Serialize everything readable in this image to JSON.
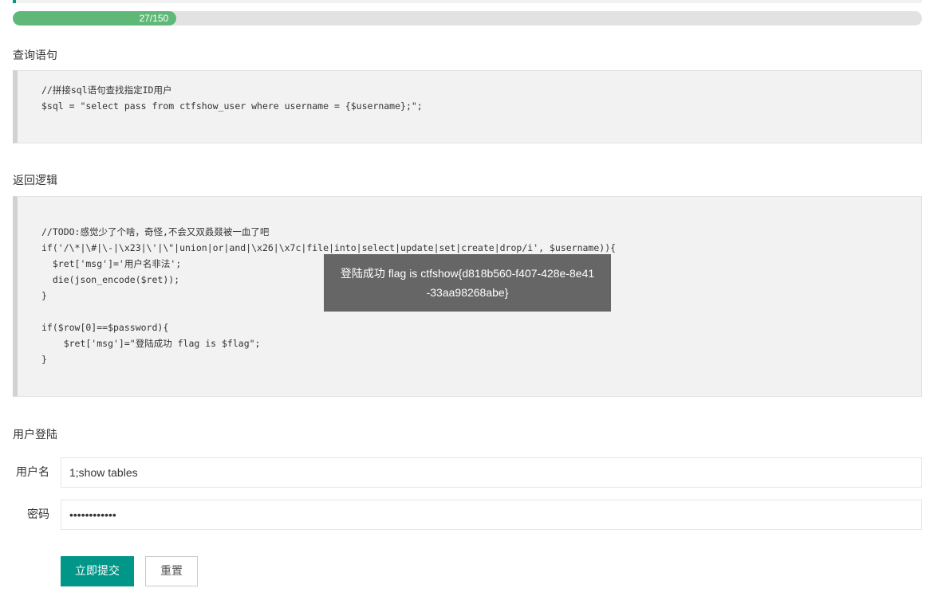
{
  "progress": {
    "text": "27/150",
    "fraction": 0.18,
    "color": "#5fb878"
  },
  "query_section": {
    "title": "查询语句",
    "lines": [
      "//拼接sql语句查找指定ID用户",
      "$sql = \"select pass from ctfshow_user where username = {$username};\";"
    ]
  },
  "logic_section": {
    "title": "返回逻辑",
    "lines": [
      "//TODO:感觉少了个啥，奇怪,不会又双叒叕被一血了吧",
      "if('/\\*|\\#|\\-|\\x23|\\'|\\\"|union|or|and|\\x26|\\x7c|file|into|select|update|set|create|drop/i', $username)){",
      "  $ret['msg']='用户名非法';",
      "  die(json_encode($ret));",
      "}",
      "",
      "if($row[0]==$password){",
      "    $ret['msg']=\"登陆成功 flag is $flag\";",
      "}"
    ]
  },
  "toast": {
    "message": "登陆成功 flag is ctfshow{d818b560-f407-428e-8e41-33aa98268abe}"
  },
  "login_section": {
    "title": "用户登陆",
    "username_label": "用户名",
    "username_value": "1;show tables",
    "password_label": "密码",
    "password_value": "••••••••••••",
    "submit_label": "立即提交",
    "reset_label": "重置"
  },
  "colors": {
    "accent": "#009688",
    "code_bg": "#f2f2f2",
    "toast_bg": "#666666"
  }
}
